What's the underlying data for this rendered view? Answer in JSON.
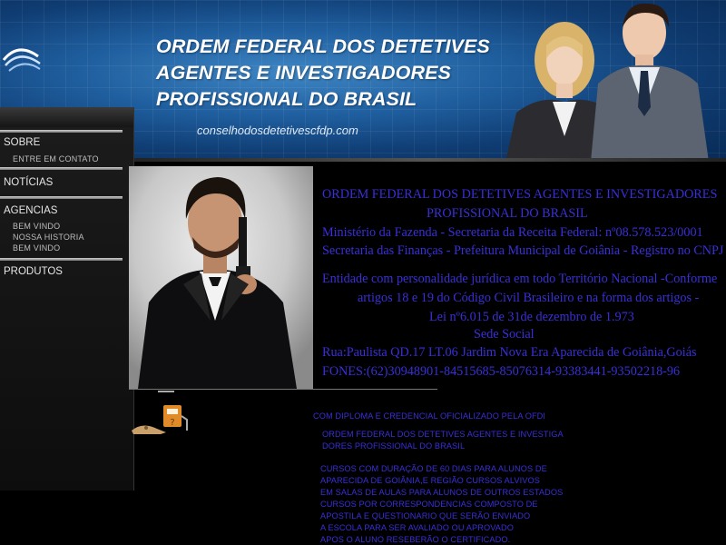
{
  "header": {
    "title_lines": [
      "ORDEM FEDERAL DOS DETETIVES",
      "AGENTES E INVESTIGADORES",
      "PROFISSIONAL DO BRASIL"
    ],
    "site": "conselhodosdetetivescfdp.com"
  },
  "sidebar": {
    "sobre": "SOBRE",
    "entre_em_contato": "ENTRE EM CONTATO",
    "noticias": "NOTÍCIAS",
    "agencias": "AGENCIAS",
    "bem_vindo_1": "BEM VINDO",
    "nossa_historia": "NOSSA HISTORIA",
    "bem_vindo_2": "BEM VINDO",
    "produtos": "PRODUTOS"
  },
  "info": {
    "line1": "ORDEM FEDERAL DOS DETETIVES AGENTES E INVESTIGADORES",
    "line2": "PROFISSIONAL DO BRASIL",
    "line3": "Ministério da  Fazenda - Secretaria da Receita  Federal: nº08.578.523/0001",
    "line4": "Secretaria das Finanças - Prefeitura Municipal de Goiânia - Registro no CNPJ",
    "line5": "Entidade  com personalidade jurídica em todo Território Nacional -Conforme",
    "line6": "artigos 18 e 19  do Código Civil Brasileiro e  na forma dos artigos -",
    "line7": "Lei nº6.015 de 31de dezembro de 1.973",
    "line8": "Sede Social",
    "line9": "Rua:Paulista  QD.17 LT.06  Jardim Nova Era Aparecida de Goiânia,Goiás",
    "line10": "FONES:(62)30948901-84515685-85076314-93383441-93502218-96"
  },
  "lower": {
    "diploma": "COM DIPLOMA E CREDENCIAL  OFICIALIZADO PELA OFDI",
    "org1": "ORDEM FEDERAL DOS DETETIVES AGENTES E INVESTIGA",
    "org2": "DORES PROFISSIONAL DO BRASIL",
    "c1": " CURSOS COM DURAÇÃO DE 60 DIAS PARA ALUNOS DE",
    "c2": "APARECIDA DE GOIÂNIA,E REGIÃO CURSOS ALVIVOS",
    "c3": "EM SALAS DE AULAS PARA ALUNOS DE OUTROS ESTADOS",
    "c4": "CURSOS POR CORRESPONDENCIAS COMPOSTO DE",
    "c5": "APOSTILA E QUESTIONARIO QUE SERÃO ENVIADO",
    "c6": "A ESCOLA  PARA  SER AVALIADO OU APROVADO",
    "c7": "APOS O ALUNO RESEBERÃO O CERTIFICADO."
  },
  "icons": [
    "swoosh-logo-icon",
    "fuel-pump-icon"
  ],
  "colors": {
    "text_blue": "#3a2fd8",
    "header_blue": "#1f5e9e"
  }
}
